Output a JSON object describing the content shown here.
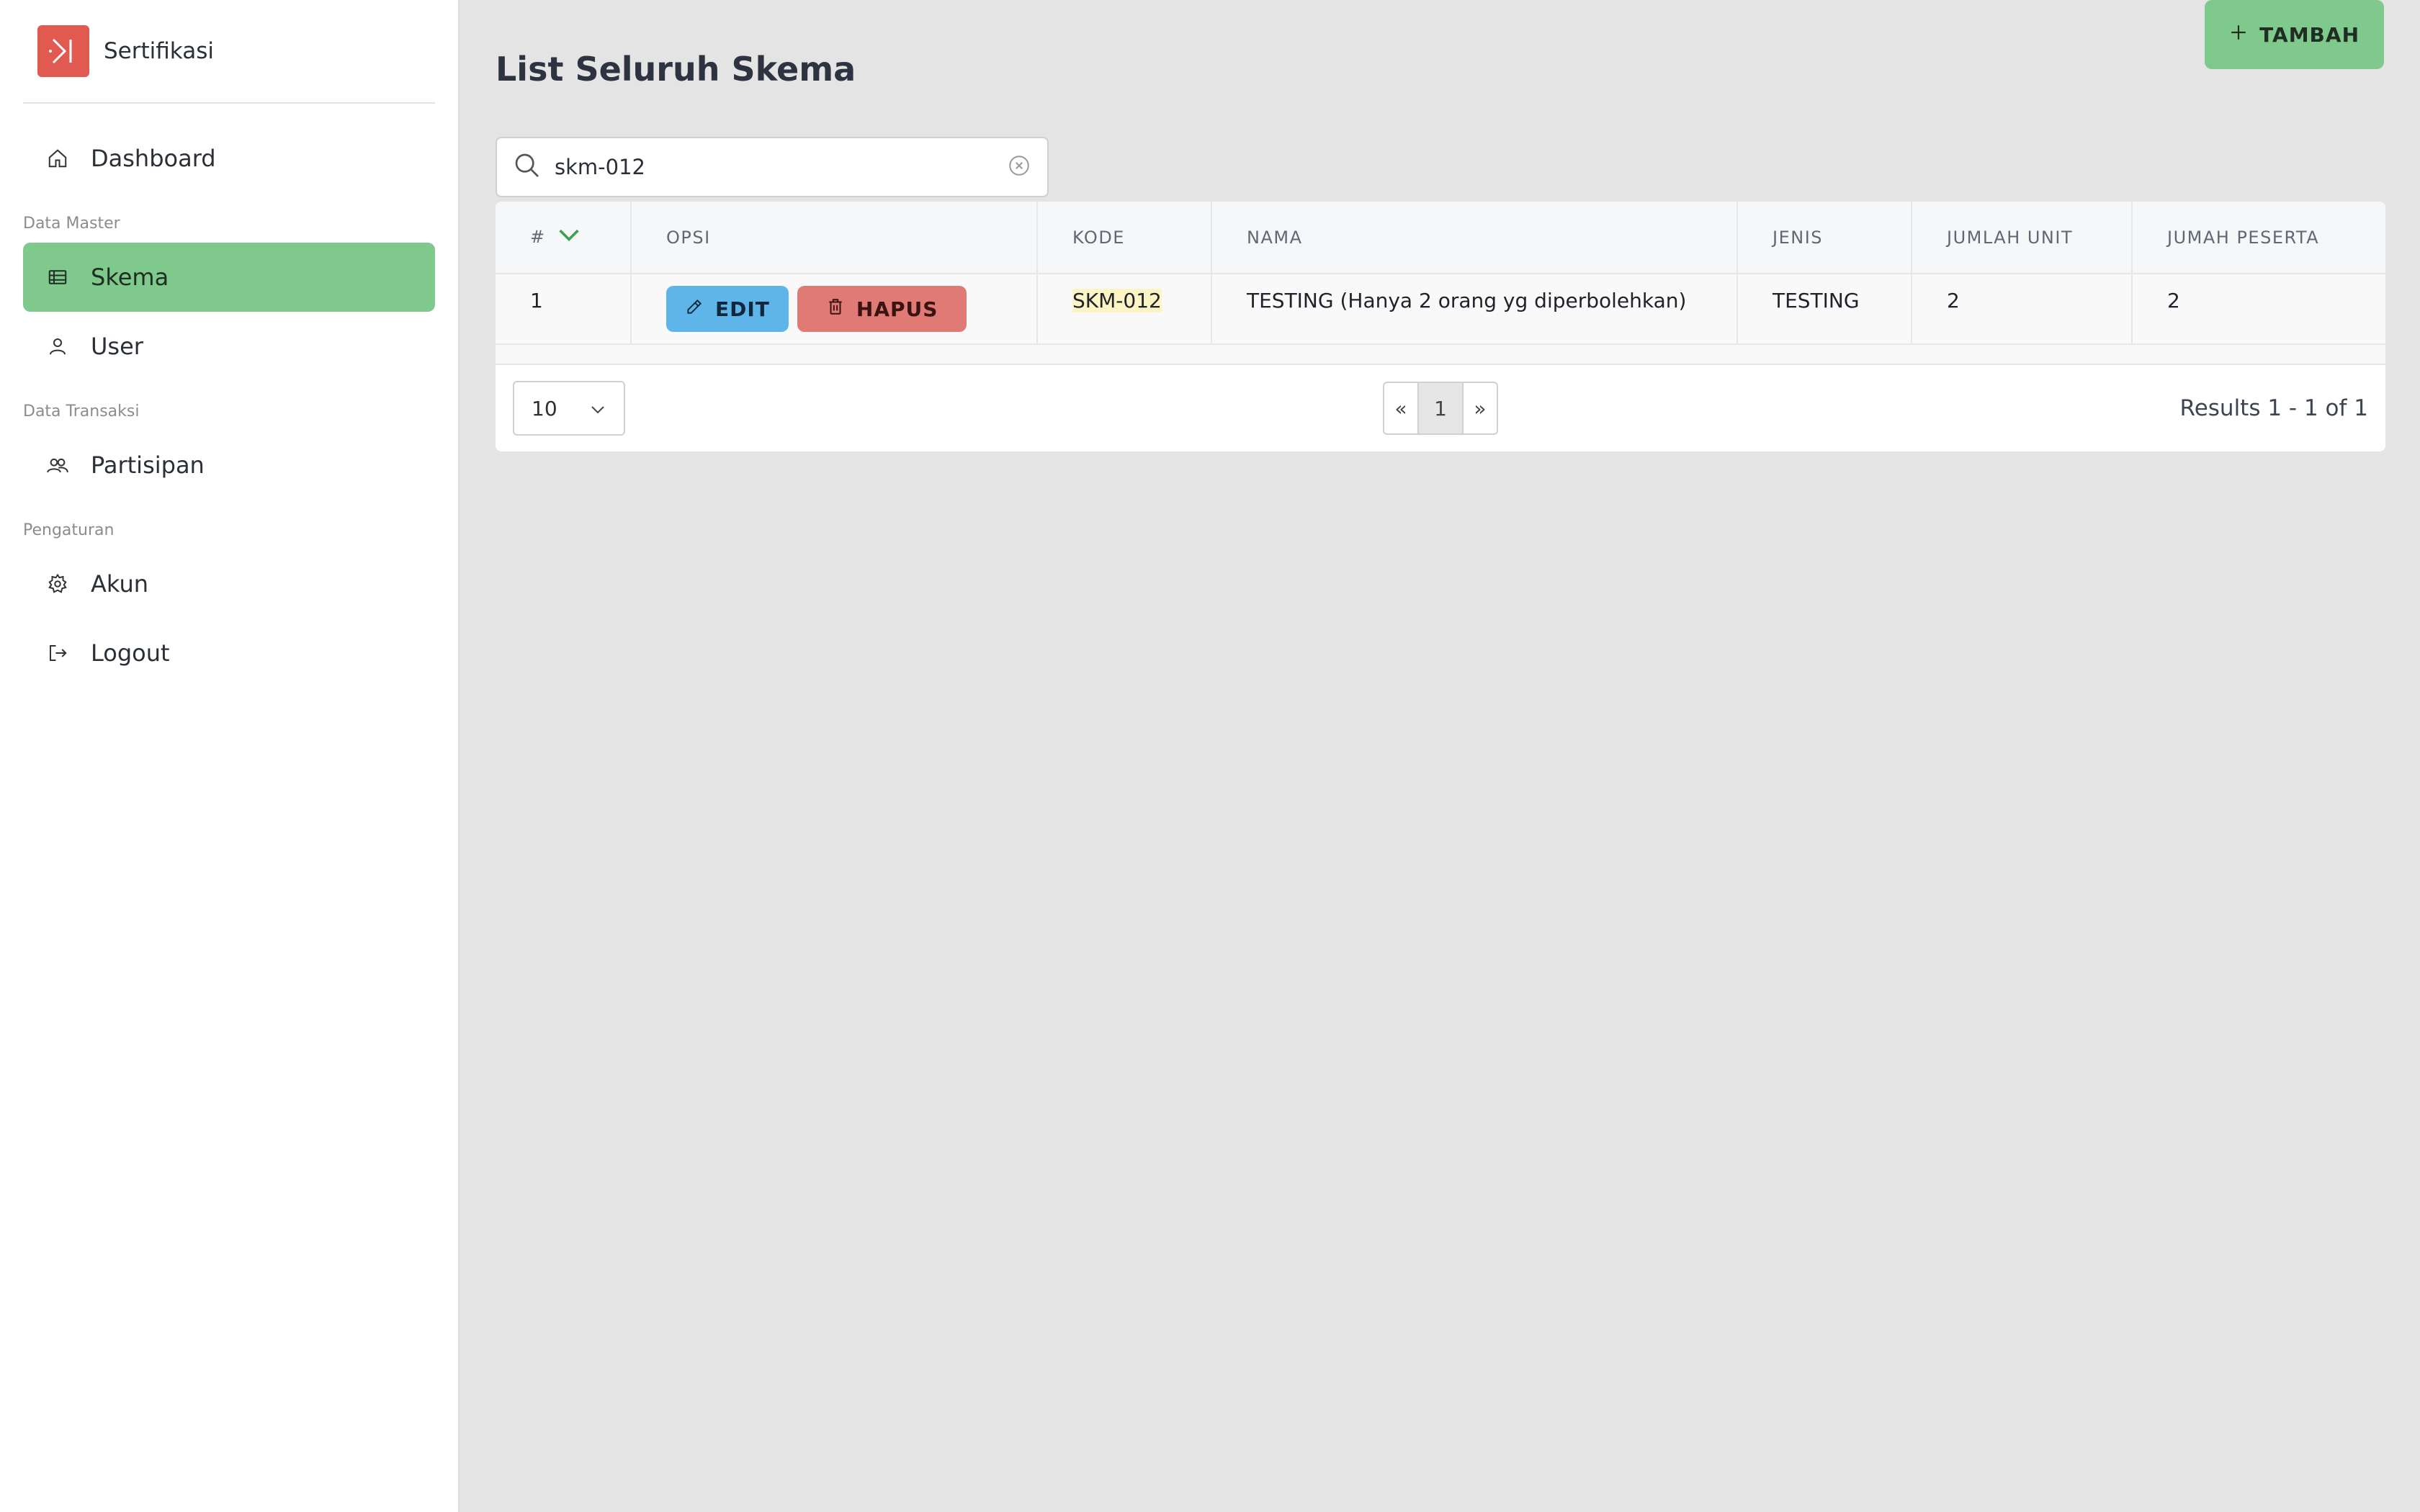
{
  "app": {
    "name": "Sertifikasi"
  },
  "sidebar": {
    "items": [
      {
        "label": "Dashboard",
        "icon": "home-icon"
      },
      {
        "section": "Data Master"
      },
      {
        "label": "Skema",
        "icon": "table-icon",
        "active": true
      },
      {
        "label": "User",
        "icon": "user-icon"
      },
      {
        "section": "Data Transaksi"
      },
      {
        "label": "Partisipan",
        "icon": "users-icon"
      },
      {
        "section": "Pengaturan"
      },
      {
        "label": "Akun",
        "icon": "gear-icon"
      },
      {
        "label": "Logout",
        "icon": "logout-icon"
      }
    ]
  },
  "page": {
    "title": "List Seluruh Skema",
    "add_label": "TAMBAH"
  },
  "search": {
    "value": "skm-012"
  },
  "table": {
    "columns": {
      "num": "#",
      "opsi": "OPSI",
      "kode": "KODE",
      "nama": "NAMA",
      "jenis": "JENIS",
      "jumlah_unit": "JUMLAH UNIT",
      "jumah_peserta": "JUMAH PESERTA"
    },
    "rows": [
      {
        "num": "1",
        "edit_label": "EDIT",
        "hapus_label": "HAPUS",
        "kode": "SKM-012",
        "nama": "TESTING (Hanya 2 orang yg diperbolehkan)",
        "jenis": "TESTING",
        "jumlah_unit": "2",
        "jumah_peserta": "2"
      }
    ]
  },
  "footer": {
    "page_size": "10",
    "prev": "«",
    "current_page": "1",
    "next": "»",
    "results": "Results 1 - 1 of 1"
  },
  "colors": {
    "accent_green": "#7fc98c",
    "edit_blue": "#5db5ea",
    "hapus_red": "#e07a74",
    "logo_red": "#e05a52"
  }
}
